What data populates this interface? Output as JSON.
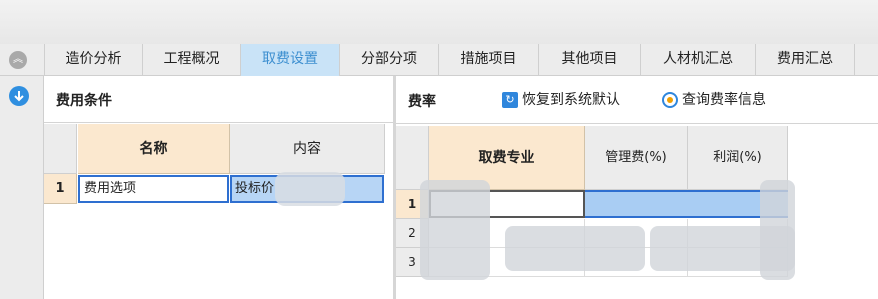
{
  "tabs": [
    {
      "label": "造价分析",
      "active": false
    },
    {
      "label": "工程概况",
      "active": false
    },
    {
      "label": "取费设置",
      "active": true
    },
    {
      "label": "分部分项",
      "active": false
    },
    {
      "label": "措施项目",
      "active": false
    },
    {
      "label": "其他项目",
      "active": false
    },
    {
      "label": "人材机汇总",
      "active": false
    },
    {
      "label": "费用汇总",
      "active": false
    }
  ],
  "left_panel": {
    "title": "费用条件",
    "columns": [
      "名称",
      "内容"
    ],
    "rows": [
      {
        "num": "1",
        "name": "费用选项",
        "value": "投标价"
      }
    ]
  },
  "right_panel": {
    "title": "费率",
    "restore_label": "恢复到系统默认",
    "query_label": "查询费率信息",
    "columns": [
      "取费专业",
      "管理费(%)",
      "利润(%)"
    ],
    "row_numbers": [
      "1",
      "2",
      "3"
    ]
  },
  "colors": {
    "active_tab_bg": "#c9e3f7",
    "active_tab_text": "#3d8fd0",
    "header_highlight": "#fbe8cf",
    "selection_border": "#2e6fd0",
    "selection_fill": "#b7d5f5"
  },
  "icons": {
    "collapse": "double-chevron-up-icon",
    "download": "download-arrow-icon",
    "restore": "restore-icon",
    "query": "query-rate-icon"
  }
}
